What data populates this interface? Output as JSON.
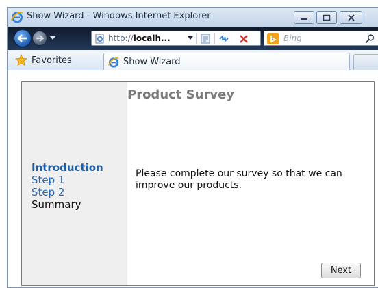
{
  "window": {
    "title": "Show Wizard - Windows Internet Explorer"
  },
  "address_bar": {
    "url_prefix": "http://",
    "url_host": "localh...",
    "search_placeholder": "Bing"
  },
  "favorites_bar": {
    "favorites_label": "Favorites",
    "tab_label": "Show Wizard"
  },
  "wizard": {
    "title": "Product Survey",
    "steps": [
      {
        "label": "Introduction",
        "state": "active"
      },
      {
        "label": "Step 1",
        "state": "link"
      },
      {
        "label": "Step 2",
        "state": "link"
      },
      {
        "label": "Summary",
        "state": "plain"
      }
    ],
    "body_text": "Please complete our survey so that we can improve our products.",
    "next_label": "Next"
  },
  "icons": {
    "browser_logo": "ie-logo-icon",
    "back": "back-arrow-icon",
    "forward": "forward-arrow-icon",
    "compat": "compatibility-view-icon",
    "refresh": "refresh-icon",
    "stop": "stop-icon",
    "search_provider": "bing-logo-icon",
    "search": "search-icon",
    "favorites": "favorites-star-icon"
  },
  "colors": {
    "active_step": "#1f5fa8",
    "link_step": "#2a6ab5",
    "wizard_title": "#7b7b7b",
    "sidebar_bg": "#efefef",
    "nav_bar": "#1a2a44"
  }
}
